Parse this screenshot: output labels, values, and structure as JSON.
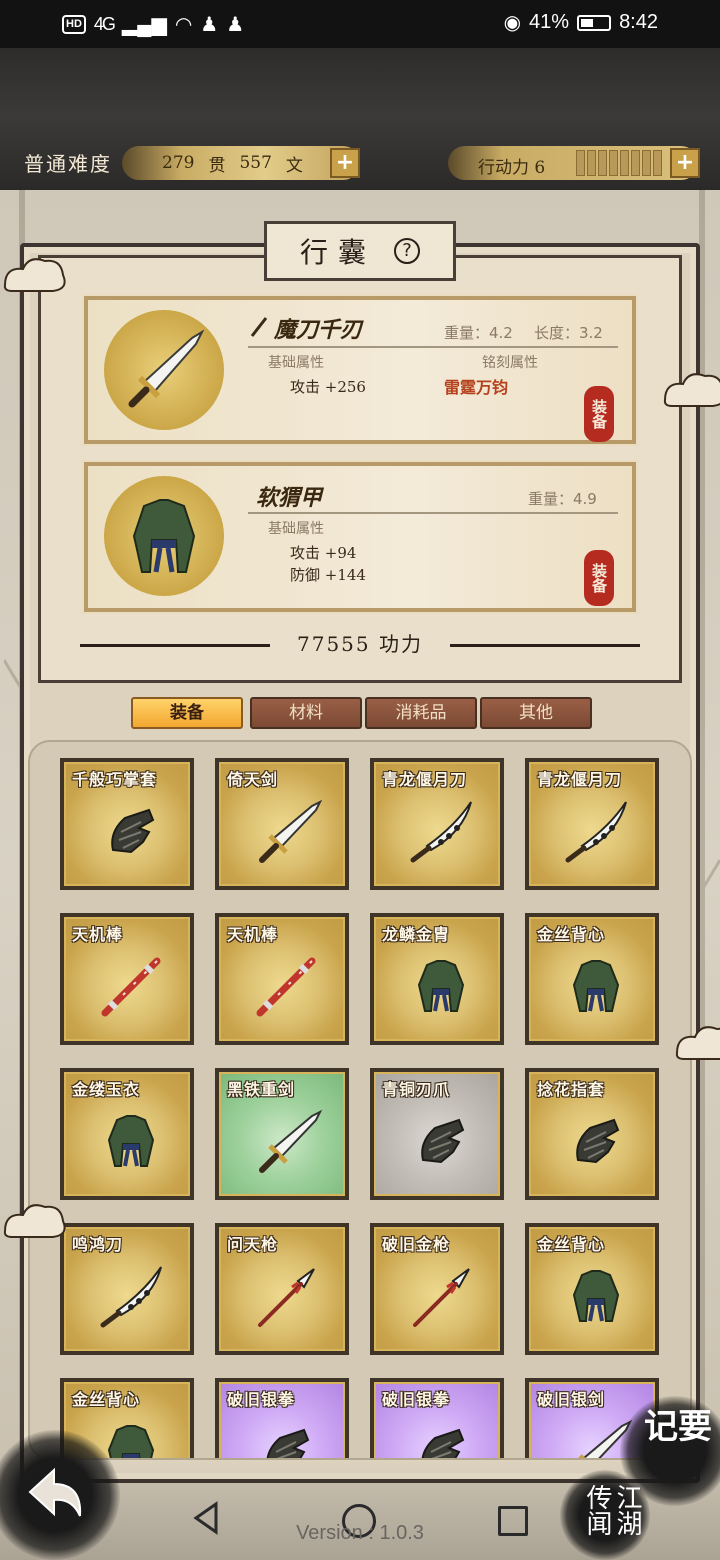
{
  "status_bar": {
    "hd": "HD",
    "network": "4G",
    "battery": "41%",
    "time": "8:42"
  },
  "header": {
    "difficulty": "普通难度",
    "money": {
      "guan": "279",
      "guan_unit": "贯",
      "wen": "557",
      "wen_unit": "文"
    },
    "action_label": "行动力 6"
  },
  "title": "行囊",
  "equipped": [
    {
      "name": "魔刀千刃",
      "weight": "重量：4.2",
      "length": "长度：3.2",
      "base_header": "基础属性",
      "base_stats": [
        "攻击 +256"
      ],
      "engrave_header": "铭刻属性",
      "engrave": "雷霆万钧",
      "seal": "装备",
      "icon": "sword-icon"
    },
    {
      "name": "软猬甲",
      "weight": "重量：4.9",
      "base_header": "基础属性",
      "base_stats": [
        "攻击 +94",
        "防御 +144"
      ],
      "seal": "装备",
      "icon": "armor-icon"
    }
  ],
  "power": "77555 功力",
  "tabs": [
    "装备",
    "材料",
    "消耗品",
    "其他"
  ],
  "active_tab": "装备",
  "inventory": [
    {
      "name": "千般巧掌套",
      "rarity": "gold",
      "icon": "gauntlet-icon"
    },
    {
      "name": "倚天剑",
      "rarity": "gold",
      "icon": "sword-icon"
    },
    {
      "name": "青龙偃月刀",
      "rarity": "gold",
      "icon": "saber-icon"
    },
    {
      "name": "青龙偃月刀",
      "rarity": "gold",
      "icon": "saber-icon"
    },
    {
      "name": "天机棒",
      "rarity": "gold",
      "icon": "staff-icon"
    },
    {
      "name": "天机棒",
      "rarity": "gold",
      "icon": "staff-icon"
    },
    {
      "name": "龙鳞金胄",
      "rarity": "gold",
      "icon": "armor-icon"
    },
    {
      "name": "金丝背心",
      "rarity": "gold",
      "icon": "armor-icon"
    },
    {
      "name": "金缕玉衣",
      "rarity": "gold",
      "icon": "armor-icon"
    },
    {
      "name": "黑铁重剑",
      "rarity": "green",
      "icon": "sword-icon"
    },
    {
      "name": "青铜刃爪",
      "rarity": "gray",
      "icon": "gauntlet-icon"
    },
    {
      "name": "捻花指套",
      "rarity": "gold",
      "icon": "gauntlet-icon"
    },
    {
      "name": "鸣鸿刀",
      "rarity": "gold",
      "icon": "saber-icon"
    },
    {
      "name": "问天枪",
      "rarity": "gold",
      "icon": "spear-icon"
    },
    {
      "name": "破旧金枪",
      "rarity": "gold",
      "icon": "spear-icon"
    },
    {
      "name": "金丝背心",
      "rarity": "gold",
      "icon": "armor-icon"
    },
    {
      "name": "金丝背心",
      "rarity": "gold",
      "icon": "armor-icon"
    },
    {
      "name": "破旧银拳",
      "rarity": "purple",
      "icon": "gauntlet-icon"
    },
    {
      "name": "破旧银拳",
      "rarity": "purple",
      "icon": "gauntlet-icon"
    },
    {
      "name": "破旧银剑",
      "rarity": "purple",
      "icon": "sword-icon"
    }
  ],
  "side_buttons": {
    "notes": "记要",
    "rumors": "江湖传闻"
  },
  "version": "Version : 1.0.3"
}
